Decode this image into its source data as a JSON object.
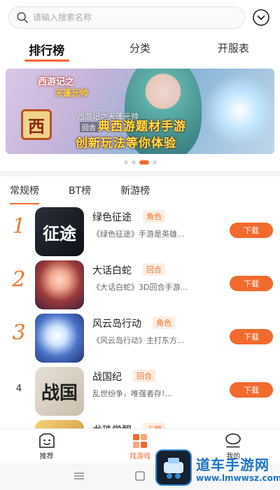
{
  "search": {
    "placeholder": "请输入搜索名称"
  },
  "main_tabs": [
    {
      "label": "排行榜",
      "active": true
    },
    {
      "label": "分类",
      "active": false
    },
    {
      "label": "开服表",
      "active": false
    }
  ],
  "banner": {
    "logo_line1": "西游记之",
    "logo_line2": "天蓬元帅",
    "seal_char": "西",
    "game_name": "西游记之天蓬元帅",
    "tag": "回合",
    "slogan_line1": "典西游题材手游",
    "slogan_line2": "创新玩法等你体验",
    "active_slide": 3,
    "slide_count": 4
  },
  "sub_tabs": [
    {
      "label": "常规榜",
      "active": true
    },
    {
      "label": "BT榜",
      "active": false
    },
    {
      "label": "新游榜",
      "active": false
    }
  ],
  "list": [
    {
      "rank": "1",
      "name": "绿色征途",
      "tag": "角色",
      "desc": "《绿色征途》手游是英雄...",
      "icon_text": "征途",
      "button": "下载"
    },
    {
      "rank": "2",
      "name": "大话白蛇",
      "tag": "回合",
      "desc": "《大话白蛇》3D回合手游...",
      "icon_text": "",
      "button": "下载"
    },
    {
      "rank": "3",
      "name": "风云岛行动",
      "tag": "角色",
      "desc": "《风云岛行动》主打东方...",
      "icon_text": "",
      "button": "下载"
    },
    {
      "rank": "4",
      "name": "战国纪",
      "tag": "回合",
      "desc": "乱世纷争，唯强者存!...",
      "icon_text": "战国",
      "button": "下载"
    },
    {
      "rank": "",
      "name": "龙珠觉醒",
      "tag": "卡牌",
      "desc": "",
      "icon_text": "",
      "button": ""
    }
  ],
  "bottom_nav": [
    {
      "label": "推荐",
      "icon": "face-box-icon",
      "active": false
    },
    {
      "label": "找游戏",
      "icon": "grid-icon",
      "active": true
    },
    {
      "label": "我的",
      "icon": "person-icon",
      "active": false
    }
  ],
  "watermark": {
    "title": "道车手游网",
    "url": "www.lmwwsz.com"
  },
  "colors": {
    "accent": "#f26a2e",
    "watermark_blue": "#1f74c9"
  }
}
